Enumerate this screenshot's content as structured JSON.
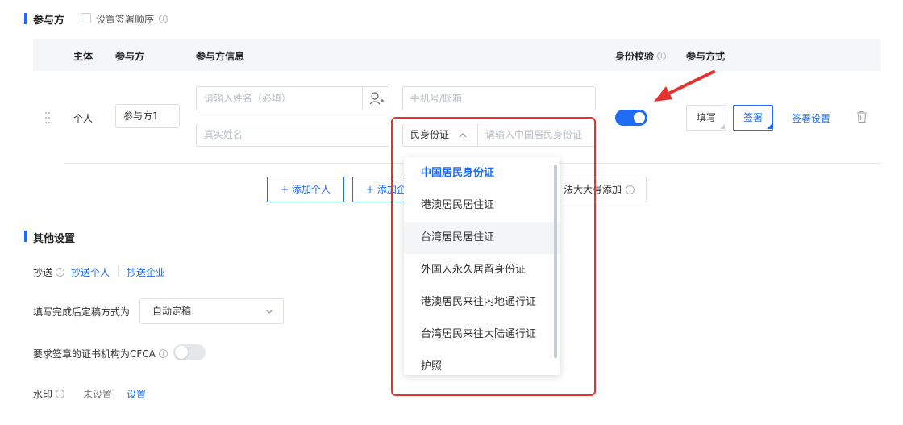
{
  "participants_section": {
    "title": "参与方",
    "set_order_label": "设置签署顺序"
  },
  "table": {
    "headers": {
      "subject": "主体",
      "party": "参与方",
      "party_info": "参与方信息",
      "identity_check": "身份校验",
      "method": "参与方式"
    },
    "row": {
      "subject": "个人",
      "party_value": "参与方1",
      "name_placeholder": "请输入姓名（必填）",
      "contact_placeholder": "手机号/邮箱",
      "realname_placeholder": "真实姓名",
      "id_type": "民身份证",
      "id_placeholder": "请输入中国居民身份证",
      "identity_check_enabled": true,
      "fill_label": "填写",
      "sign_label": "签署",
      "sign_settings_label": "签署设置"
    }
  },
  "add_buttons": {
    "add_personal": "+ 添加个人",
    "add_company_partial": "+ 添加企",
    "bulk_add_partial": "法大大号添加"
  },
  "id_dropdown": {
    "options": [
      "中国居民身份证",
      "港澳居民居住证",
      "台湾居民居住证",
      "外国人永久居留身份证",
      "港澳居民来往内地通行证",
      "台湾居民来往大陆通行证",
      "护照"
    ],
    "selected_index": 0,
    "hover_index": 2
  },
  "other_settings": {
    "title": "其他设置",
    "cc_label": "抄送",
    "cc_personal": "抄送个人",
    "cc_company": "抄送企业",
    "finalize_label": "填写完成后定稿方式为",
    "finalize_value": "自动定稿",
    "cfca_label": "要求签章的证书机构为CFCA",
    "cfca_enabled": false,
    "watermark_label": "水印",
    "watermark_status": "未设置",
    "watermark_link": "设置"
  },
  "colors": {
    "accent": "#1f6bf5",
    "highlight_red": "#e5322d",
    "table_header_bg": "#f5f6f8"
  }
}
